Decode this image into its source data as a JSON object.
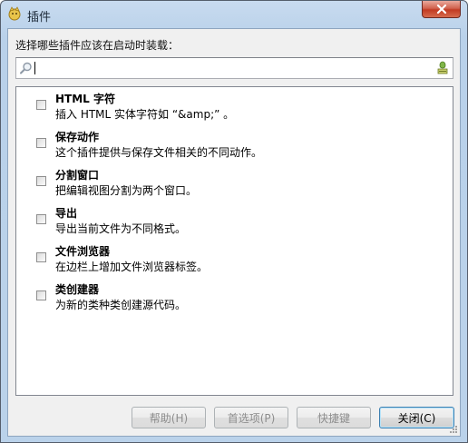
{
  "window": {
    "title": "插件",
    "app_icon": "app-icon",
    "close_icon": "close-icon"
  },
  "prompt": "选择哪些插件应该在启动时装载：",
  "search": {
    "value": "",
    "placeholder": "",
    "left_icon": "search-icon",
    "right_icon": "clear-icon"
  },
  "plugins": [
    {
      "title": "HTML 字符",
      "desc": "插入 HTML 实体字符如 “&amp;” 。",
      "checked": false
    },
    {
      "title": "保存动作",
      "desc": "这个插件提供与保存文件相关的不同动作。",
      "checked": false
    },
    {
      "title": "分割窗口",
      "desc": "把编辑视图分割为两个窗口。",
      "checked": false
    },
    {
      "title": "导出",
      "desc": "导出当前文件为不同格式。",
      "checked": false
    },
    {
      "title": "文件浏览器",
      "desc": "在边栏上增加文件浏览器标签。",
      "checked": false
    },
    {
      "title": "类创建器",
      "desc": "为新的类种类创建源代码。",
      "checked": false
    }
  ],
  "buttons": {
    "help": "帮助(H)",
    "prefs": "首选项(P)",
    "keys": "快捷键",
    "close": "关闭(C)"
  },
  "colors": {
    "titlebar": "#b9d1ea",
    "close_button": "#c23a22",
    "dialog_bg": "#f0f0f0",
    "default_button_border": "#3c7fb1"
  }
}
